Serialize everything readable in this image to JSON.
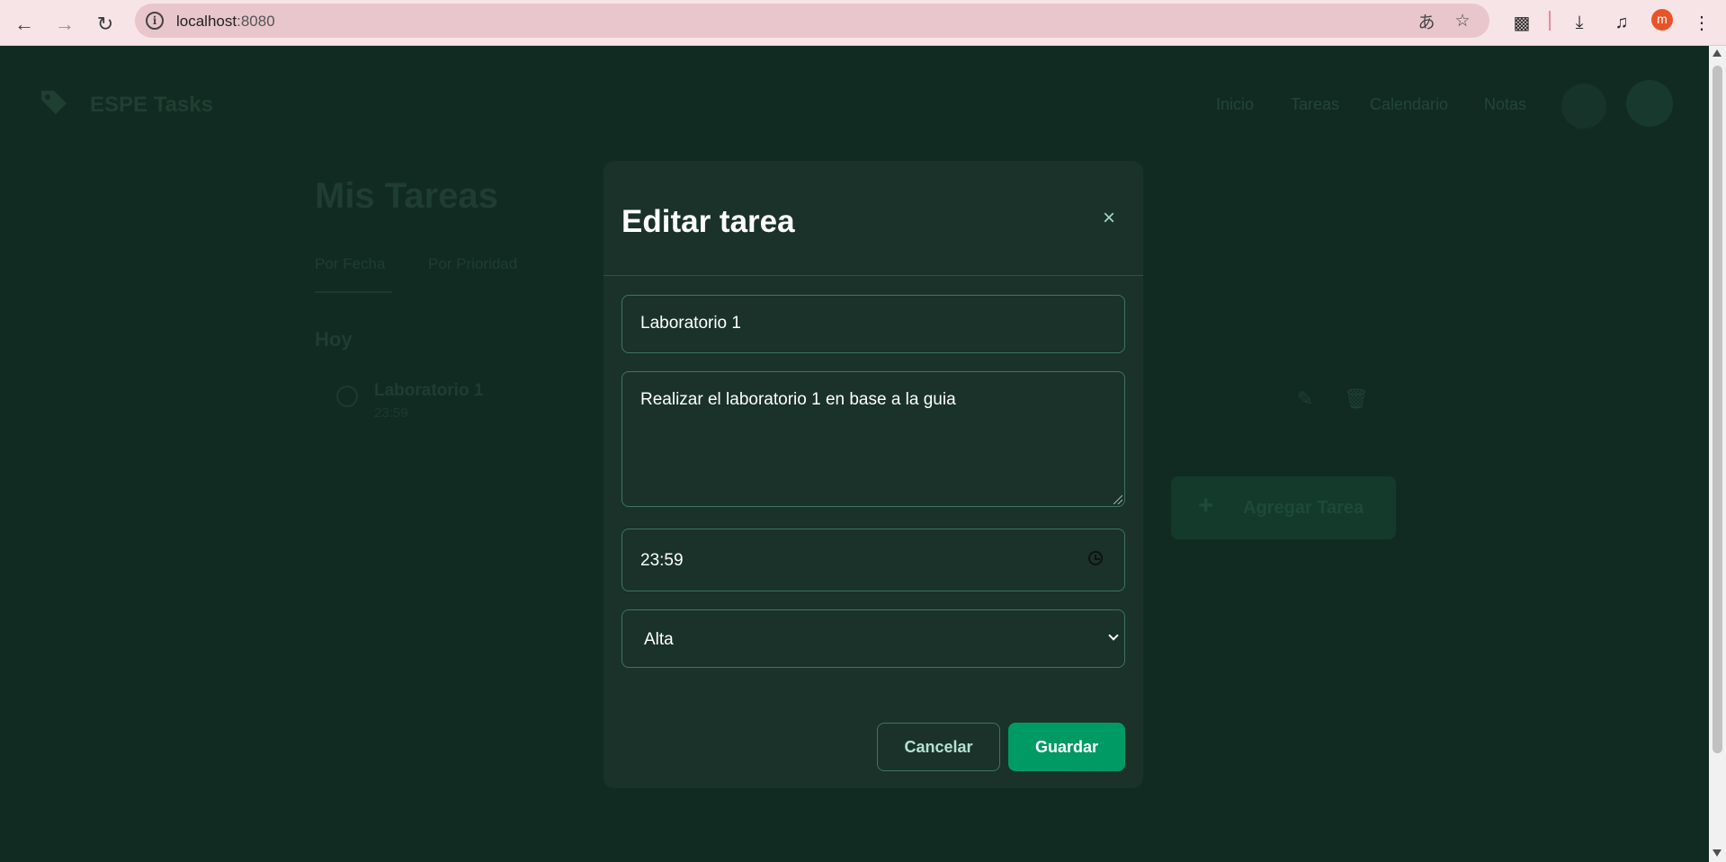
{
  "browser": {
    "url_host": "localhost",
    "url_port": ":8080",
    "profile_initial": "m",
    "icons": [
      "back-arrow-icon",
      "forward-arrow-icon",
      "reload-icon",
      "site-info-icon",
      "translate-icon",
      "bookmark-star-icon",
      "extensions-icon",
      "download-icon",
      "media-controls-icon",
      "menu-dots-icon"
    ]
  },
  "app": {
    "brand": "ESPE Tasks",
    "nav": [
      "Inicio",
      "Tareas",
      "Calendario",
      "Notas"
    ],
    "page_title": "Mis Tareas",
    "tabs": [
      "Por Fecha",
      "Por Prioridad"
    ],
    "section": "Hoy",
    "task": {
      "title": "Laboratorio 1",
      "time": "23:59"
    },
    "add_task_label": "Agregar Tarea"
  },
  "modal": {
    "title": "Editar tarea",
    "title_value": "Laboratorio 1",
    "description_value": "Realizar el laboratorio 1 en base a la guia",
    "time_value": "23:59",
    "priority_value": "Alta",
    "cancel_label": "Cancelar",
    "save_label": "Guardar",
    "close_glyph": "×"
  },
  "colors": {
    "page_bg": "#122b22",
    "modal_bg": "#1a3229",
    "accent": "#009a64",
    "border": "#3d7561"
  }
}
